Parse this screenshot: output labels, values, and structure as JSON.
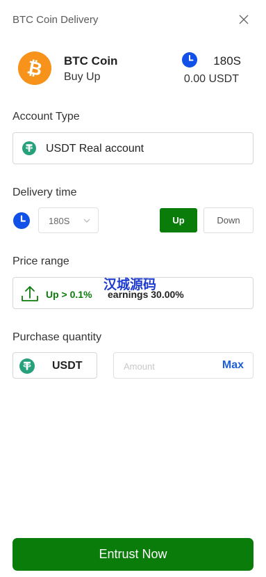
{
  "header": {
    "title": "BTC Coin Delivery"
  },
  "coin": {
    "name": "BTC Coin",
    "direction": "Buy Up",
    "time": "180S",
    "amount": "0.00 USDT"
  },
  "account": {
    "label": "Account Type",
    "value": "USDT Real account"
  },
  "delivery": {
    "label": "Delivery time",
    "selected": "180S",
    "up_label": "Up",
    "down_label": "Down"
  },
  "price": {
    "label": "Price range",
    "up_text": "Up > 0.1%",
    "earnings_text": "earnings 30.00%",
    "watermark": "汉城源码"
  },
  "purchase": {
    "label": "Purchase quantity",
    "currency": "USDT",
    "amount_placeholder": "Amount",
    "max_label": "Max"
  },
  "footer": {
    "submit_label": "Entrust Now"
  },
  "colors": {
    "brand_green": "#0a7c0a",
    "btc_orange": "#f7931a",
    "tether_green": "#26a17b",
    "clock_blue": "#1151e8",
    "max_blue": "#1d5fd8"
  }
}
